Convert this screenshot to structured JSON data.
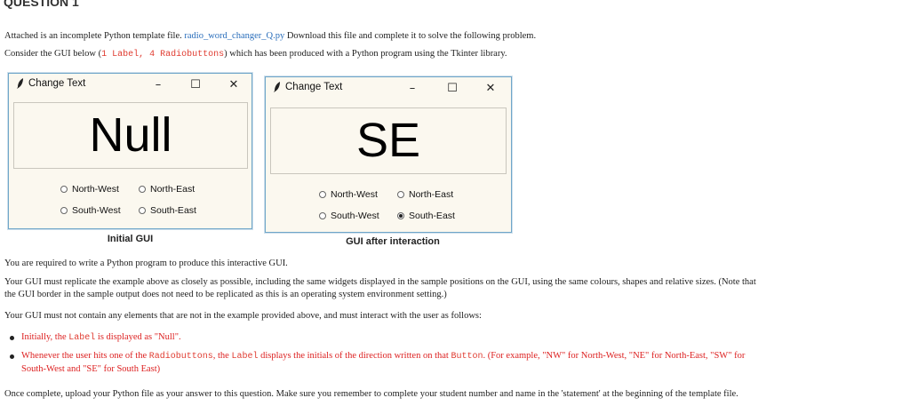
{
  "heading": "QUESTION 1",
  "intro": {
    "attached_prefix": "Attached is an incomplete Python template file.",
    "file_link": "radio_word_changer_Q.py",
    "attached_suffix": "Download this file and complete it to solve the following problem.",
    "consider_prefix": "Consider the GUI below (",
    "label_code": "1 Label",
    "comma": ", ",
    "radio_code": "4 Radiobuttons",
    "consider_suffix": ") which has been produced with a Python program using the Tkinter library."
  },
  "windows": [
    {
      "title": "Change Text",
      "controls": {
        "minimize": "–",
        "maximize": "☐",
        "close": "✕"
      },
      "label_value": "Null",
      "radios": [
        {
          "label": "North-West",
          "checked": false
        },
        {
          "label": "North-East",
          "checked": false
        },
        {
          "label": "South-West",
          "checked": false
        },
        {
          "label": "South-East",
          "checked": false
        }
      ],
      "caption": "Initial GUI"
    },
    {
      "title": "Change Text",
      "controls": {
        "minimize": "–",
        "maximize": "☐",
        "close": "✕"
      },
      "label_value": "SE",
      "radios": [
        {
          "label": "North-West",
          "checked": false
        },
        {
          "label": "North-East",
          "checked": false
        },
        {
          "label": "South-West",
          "checked": false
        },
        {
          "label": "South-East",
          "checked": true
        }
      ],
      "caption": "GUI after interaction"
    }
  ],
  "body": {
    "required": "You are required to write a Python program to produce this interactive GUI.",
    "replicate_line1": "Your GUI must replicate the example above as closely as possible, including the same widgets displayed in the sample positions on the GUI, using the same colours, shapes and relative sizes.   (Note that",
    "replicate_line2": "the GUI border in the sample output does not need to be replicated as this is an operating system environment setting.)",
    "must_not": "Your GUI must not contain any elements that are not in the example provided above, and must interact with the user as follows:",
    "bullet1": {
      "a": "Initially, the ",
      "code": "Label",
      "b": " is displayed as \"Null\"."
    },
    "bullet2": {
      "a": "Whenever the user hits one of the ",
      "code1": "Radiobuttons",
      "b": ", the ",
      "code2": "Label",
      "c": " displays the initials of the direction written on that ",
      "code3": "Button",
      "d": ". (For example, \"NW\" for North-West, \"NE\" for North-East, \"SW\" for",
      "e": "South-West and \"SE\" for South East)"
    },
    "closing": "Once complete, upload your Python file as your answer to this question.  Make sure you remember to complete your student number and name in the 'statement' at the beginning of the template file."
  }
}
